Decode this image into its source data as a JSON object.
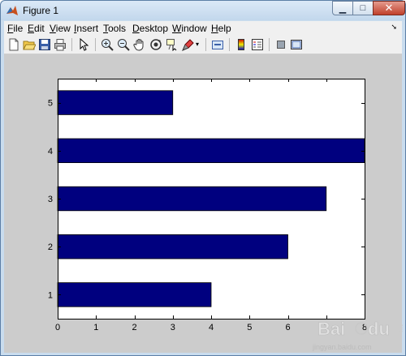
{
  "window": {
    "title": "Figure 1",
    "minimize_glyph": "▁",
    "maximize_glyph": "□",
    "close_glyph": "✕"
  },
  "menu": [
    {
      "key": "F",
      "rest": "ile"
    },
    {
      "key": "E",
      "rest": "dit"
    },
    {
      "key": "V",
      "rest": "iew"
    },
    {
      "key": "I",
      "rest": "nsert"
    },
    {
      "key": "T",
      "rest": "ools"
    },
    {
      "key": "D",
      "rest": "esktop"
    },
    {
      "key": "W",
      "rest": "indow"
    },
    {
      "key": "H",
      "rest": "elp"
    }
  ],
  "toolbar_icons": [
    "new-figure-icon",
    "open-file-icon",
    "save-icon",
    "print-icon",
    "edit-plot-arrow-icon",
    "zoom-in-icon",
    "zoom-out-icon",
    "pan-hand-icon",
    "rotate-3d-icon",
    "data-cursor-icon",
    "brush-icon",
    "link-plot-icon",
    "insert-colorbar-icon",
    "insert-legend-icon",
    "hide-plot-tools-icon",
    "show-plot-tools-icon"
  ],
  "colors": {
    "bar": "#00007f",
    "axes_bg": "#ffffff",
    "figure_bg": "#cccccc"
  },
  "watermark": {
    "brand": "Bai",
    "brand_suffix": "du",
    "tag": "经验",
    "url": "jingyan.baidu.com"
  },
  "chart_data": {
    "type": "bar",
    "orientation": "horizontal",
    "categories": [
      "1",
      "2",
      "3",
      "4",
      "5"
    ],
    "values": [
      4,
      6,
      7,
      8,
      3
    ],
    "xlim": [
      0,
      8
    ],
    "ylim": [
      0.5,
      5.5
    ],
    "xticks": [
      "0",
      "1",
      "2",
      "3",
      "4",
      "5",
      "6",
      "7",
      "8"
    ],
    "yticks": [
      "1",
      "2",
      "3",
      "4",
      "5"
    ],
    "bar_color": "#00007f",
    "grid": false
  }
}
